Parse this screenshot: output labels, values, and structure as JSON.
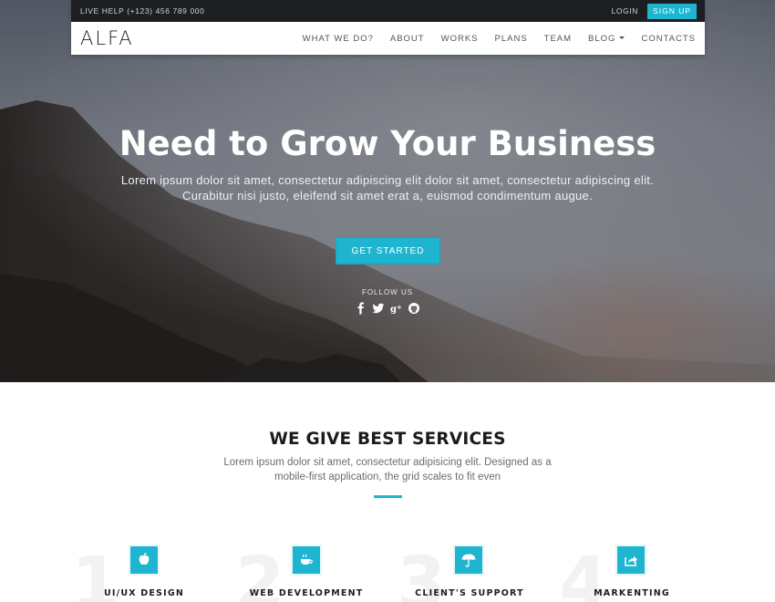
{
  "topbar": {
    "live_help": "LIVE HELP (+123) 456 789 000",
    "login": "LOGIN",
    "signup": "SIGN UP"
  },
  "navbar": {
    "logo": "ALFA",
    "items": [
      {
        "label": "WHAT WE DO?"
      },
      {
        "label": "ABOUT"
      },
      {
        "label": "WORKS"
      },
      {
        "label": "PLANS"
      },
      {
        "label": "TEAM"
      },
      {
        "label": "BLOG"
      },
      {
        "label": "CONTACTS"
      }
    ]
  },
  "hero": {
    "title": "Need to Grow Your Business",
    "subtitle_line1": "Lorem ipsum dolor sit amet, consectetur adipiscing elit dolor sit amet, consectetur adipiscing elit.",
    "subtitle_line2": "Curabitur nisi justo, eleifend sit amet erat a, euismod condimentum augue.",
    "cta": "GET STARTED",
    "follow_label": "FOLLOW US",
    "socials": [
      "facebook-icon",
      "twitter-icon",
      "google-plus-icon",
      "github-icon"
    ]
  },
  "services": {
    "title": "WE GIVE BEST SERVICES",
    "desc_line1": "Lorem ipsum dolor sit amet, consectetur adipisicing elit. Designed as a",
    "desc_line2": "mobile-first application, the grid scales to fit even",
    "features": [
      {
        "number": "1",
        "label": "UI/UX DESIGN",
        "icon": "apple-icon"
      },
      {
        "number": "2",
        "label": "WEB DEVELOPMENT",
        "icon": "coffee-cup-icon"
      },
      {
        "number": "3",
        "label": "CLIENT'S SUPPORT",
        "icon": "umbrella-icon"
      },
      {
        "number": "4",
        "label": "MARKENTING",
        "icon": "share-icon"
      }
    ]
  },
  "colors": {
    "accent": "#1fb5d1",
    "topbar_bg": "#1c1e22"
  }
}
